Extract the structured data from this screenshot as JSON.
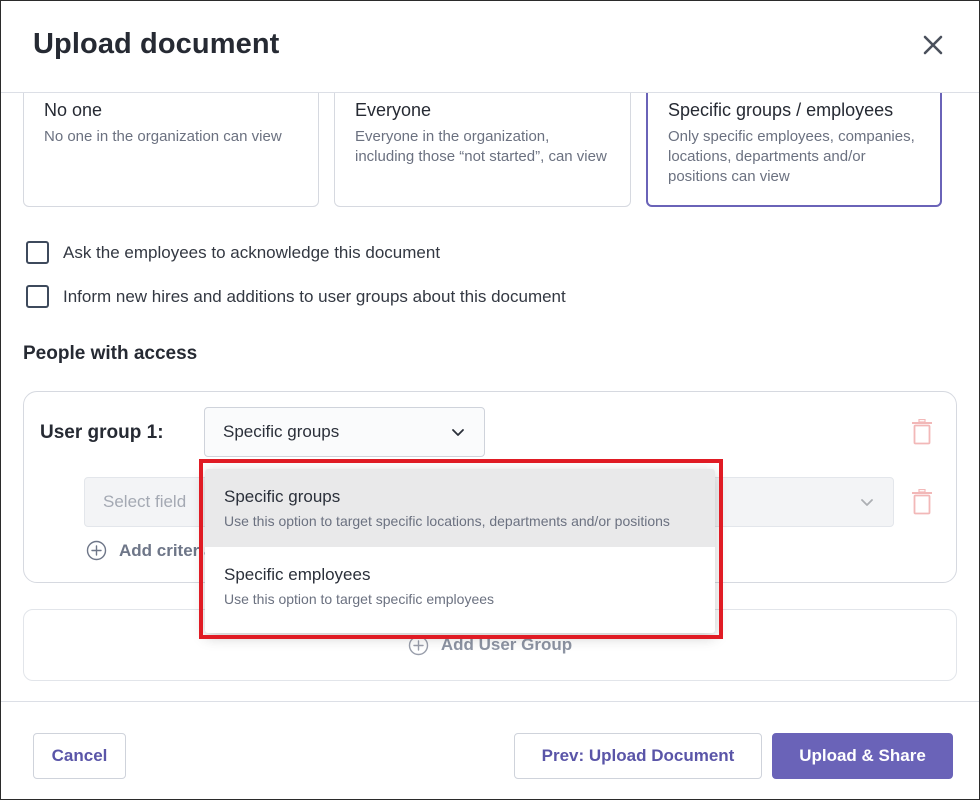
{
  "header": {
    "title": "Upload document"
  },
  "visibility_options": [
    {
      "title": "No one",
      "description": "No one in the organization can view"
    },
    {
      "title": "Everyone",
      "description": "Everyone in the organization, including those “not started”, can view"
    },
    {
      "title": "Specific groups / employees",
      "description": "Only specific employees, companies, locations, departments and/or positions can view",
      "selected": true
    }
  ],
  "checkboxes": {
    "acknowledge": {
      "label": "Ask the employees to acknowledge this document",
      "checked": false
    },
    "inform": {
      "label": "Inform new hires and additions to user groups about this document",
      "checked": false
    }
  },
  "access": {
    "section_title": "People with access",
    "user_group": {
      "label": "User group 1:",
      "selected_type": "Specific groups",
      "field_placeholder": "Select field",
      "add_criteria_label": "Add criteria"
    },
    "add_user_group_label": "Add User Group"
  },
  "dropdown": {
    "options": [
      {
        "title": "Specific groups",
        "description": "Use this option to target specific locations, departments and/or positions",
        "active": true
      },
      {
        "title": "Specific employees",
        "description": "Use this option to target specific employees",
        "active": false
      }
    ]
  },
  "footer": {
    "cancel_label": "Cancel",
    "prev_label": "Prev: Upload Document",
    "primary_label": "Upload & Share"
  },
  "colors": {
    "accent": "#6a63b8",
    "highlight": "#e01b24",
    "delete_icon": "#f2b8b8"
  }
}
